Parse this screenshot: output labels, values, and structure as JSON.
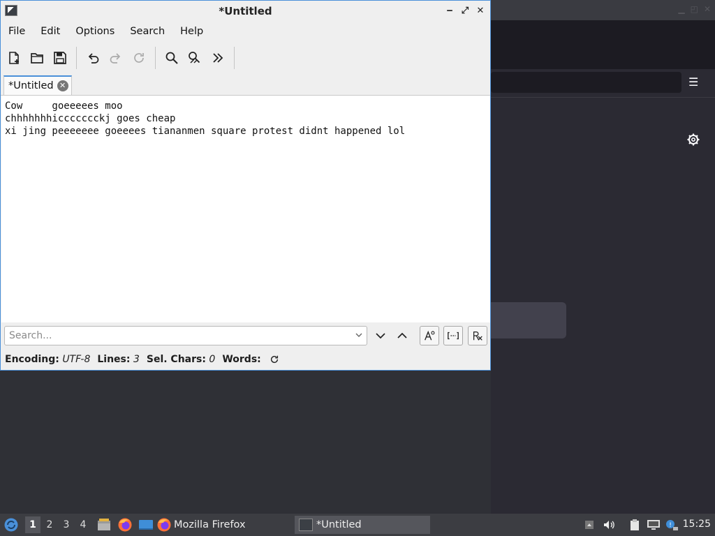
{
  "editor": {
    "title": "*Untitled",
    "menu": [
      "File",
      "Edit",
      "Options",
      "Search",
      "Help"
    ],
    "tab_label": "*Untitled",
    "text_lines": [
      "Cow     goeeeees moo",
      "chhhhhhhiccccccckj goes cheap",
      "xi jing peeeeeee goeeees tiananmen square protest didnt happened lol"
    ],
    "search_placeholder": "Search...",
    "status": {
      "encoding_label": "Encoding:",
      "encoding_value": "UTF-8",
      "lines_label": "Lines:",
      "lines_value": "3",
      "sel_label": "Sel. Chars:",
      "sel_value": "0",
      "words_label": "Words:"
    }
  },
  "taskbar": {
    "workspaces": [
      "1",
      "2",
      "3",
      "4"
    ],
    "tasks": {
      "firefox": "Mozilla Firefox",
      "editor": "*Untitled"
    },
    "clock": "15:25"
  },
  "colors": {
    "accent": "#4a90d9",
    "taskbar_bg": "#3c3d42",
    "desktop_bg": "#2f3036"
  }
}
